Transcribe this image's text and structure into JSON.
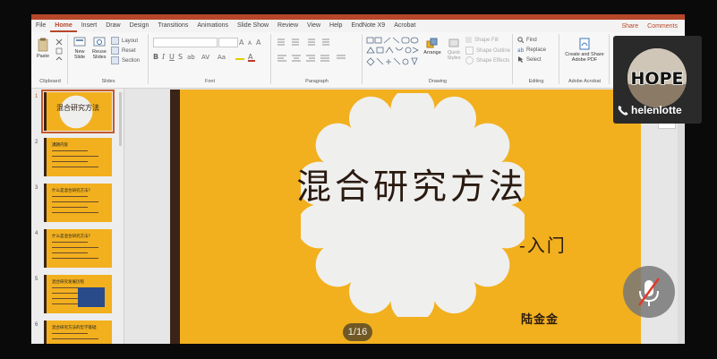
{
  "ribbon_tabs": [
    "File",
    "Home",
    "Insert",
    "Draw",
    "Design",
    "Transitions",
    "Animations",
    "Slide Show",
    "Review",
    "View",
    "Help",
    "EndNote X9",
    "Acrobat"
  ],
  "active_tab": "Home",
  "share_label": "Share",
  "comments_label": "Comments",
  "clipboard": {
    "paste": "Paste",
    "group": "Clipboard"
  },
  "slides_group": {
    "new_slide": "New Slide",
    "reuse_slides": "Reuse Slides",
    "layout": "Layout",
    "reset": "Reset",
    "section": "Section",
    "group": "Slides"
  },
  "font_group": "Font",
  "paragraph_group": "Paragraph",
  "drawing": {
    "arrange": "Arrange",
    "quick_styles": "Quick Styles",
    "shape_fill": "Shape Fill",
    "shape_outline": "Shape Outline",
    "shape_effects": "Shape Effects",
    "group": "Drawing"
  },
  "editing": {
    "find": "Find",
    "replace": "Replace",
    "select": "Select",
    "group": "Editing"
  },
  "acrobat": {
    "create_share": "Create and Share Adobe PDF",
    "group": "Adobe Acrobat"
  },
  "thumbnails": [
    {
      "num": "1",
      "title": "混合研究方法"
    },
    {
      "num": "2",
      "title": "課題内容"
    },
    {
      "num": "3",
      "title": "什么是混合研究方法？"
    },
    {
      "num": "4",
      "title": "什么是混合研究方法？"
    },
    {
      "num": "5",
      "title": "混合研究发展历程"
    },
    {
      "num": "6",
      "title": "混合研究方法的哲学基础"
    }
  ],
  "slide": {
    "title": "混合研究方法",
    "subtitle": "-入门",
    "author": "陆金金"
  },
  "pager": "1/16",
  "participant": {
    "name": "helenlotte",
    "avatar_text": "HOPE"
  },
  "colors": {
    "accent": "#b7472a",
    "slide_bg": "#f2b01e",
    "bar": "#3a2418"
  }
}
